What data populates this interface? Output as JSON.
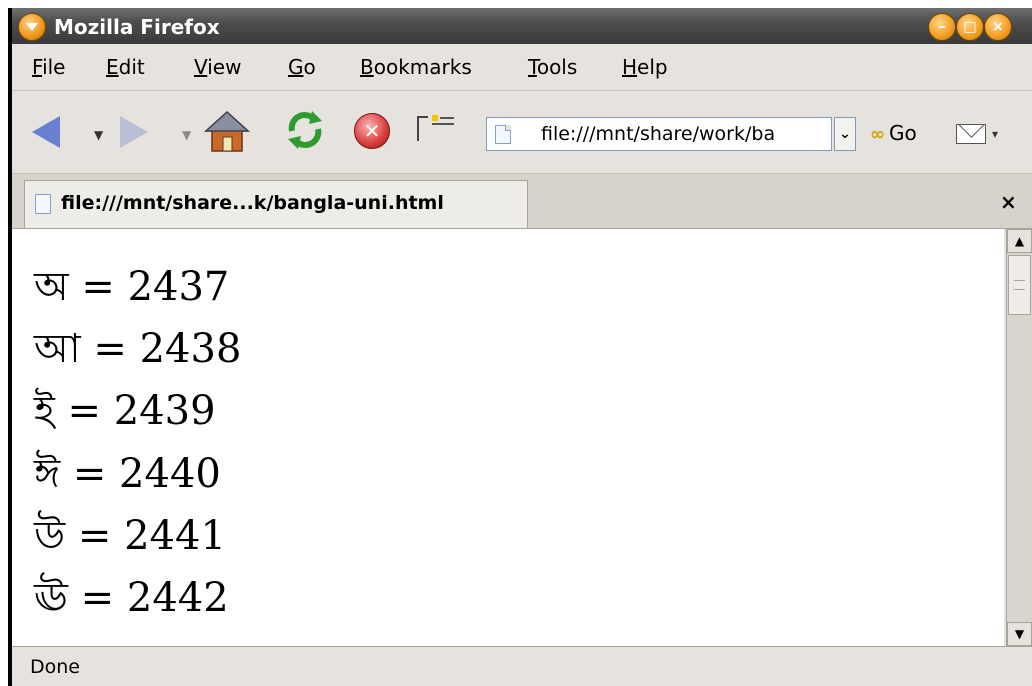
{
  "window": {
    "title": "Mozilla Firefox",
    "controls": {
      "minimize": "–",
      "maximize": "□",
      "close": "×"
    }
  },
  "menubar": {
    "items": [
      {
        "label": "File",
        "accesskey": "F",
        "rest": "ile"
      },
      {
        "label": "Edit",
        "accesskey": "E",
        "rest": "dit"
      },
      {
        "label": "View",
        "accesskey": "V",
        "rest": "iew"
      },
      {
        "label": "Go",
        "accesskey": "G",
        "rest": "o"
      },
      {
        "label": "Bookmarks",
        "accesskey": "B",
        "rest": "ookmarks"
      },
      {
        "label": "Tools",
        "accesskey": "T",
        "rest": "ools"
      },
      {
        "label": "Help",
        "accesskey": "H",
        "rest": "elp"
      }
    ]
  },
  "toolbar": {
    "url": "file:///mnt/share/work/ba",
    "go_label": "Go",
    "icons": [
      "back-icon",
      "forward-icon",
      "home-icon",
      "reload-icon",
      "stop-icon",
      "throbber-icon",
      "mail-icon"
    ]
  },
  "tabs": [
    {
      "label": "file:///mnt/share...k/bangla-uni.html",
      "close": "×"
    }
  ],
  "content": {
    "lines": [
      "অ = 2437",
      "আ = 2438",
      "ই = 2439",
      "ঈ = 2440",
      "উ = 2441",
      "ঊ = 2442"
    ]
  },
  "statusbar": {
    "text": "Done"
  }
}
